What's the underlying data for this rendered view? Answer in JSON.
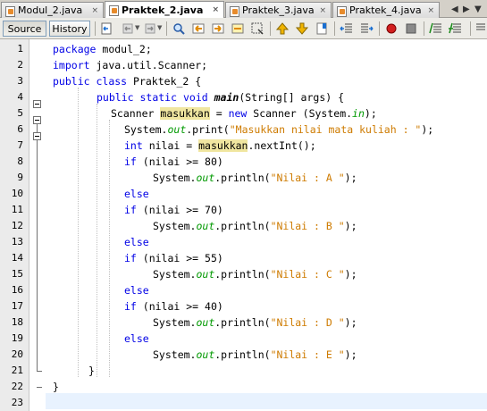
{
  "tabs": [
    {
      "label": "Modul_2.java",
      "active": false
    },
    {
      "label": "Praktek_2.java",
      "active": true
    },
    {
      "label": "Praktek_3.java",
      "active": false
    },
    {
      "label": "Praktek_4.java",
      "active": false
    }
  ],
  "tab_close_glyph": "×",
  "toolbar": {
    "source_label": "Source",
    "history_label": "History"
  },
  "code": {
    "line_numbers": [
      "1",
      "2",
      "3",
      "4",
      "5",
      "6",
      "7",
      "8",
      "9",
      "10",
      "11",
      "12",
      "13",
      "14",
      "15",
      "16",
      "17",
      "18",
      "19",
      "20",
      "21",
      "22",
      "23"
    ],
    "lines": {
      "l1": [
        "package",
        " modul_2;"
      ],
      "l2": [
        "import",
        " java.util.Scanner;"
      ],
      "l3": [
        "public",
        " ",
        "class",
        " Praktek_2 {"
      ],
      "l4": [
        "public",
        " ",
        "static",
        " ",
        "void",
        " ",
        "main",
        "(String[] args) {"
      ],
      "l5": [
        "Scanner ",
        "masukkan",
        " = ",
        "new",
        " Scanner (System.",
        "in",
        ");"
      ],
      "l6": [
        "System.",
        "out",
        ".print(",
        "\"Masukkan nilai mata kuliah : \"",
        ");"
      ],
      "l7": [
        "int",
        " nilai = ",
        "masukkan",
        ".nextInt();"
      ],
      "l8": [
        "if",
        " (nilai >= 80)"
      ],
      "l9": [
        "System.",
        "out",
        ".println(",
        "\"Nilai : A \"",
        ");"
      ],
      "l10": [
        "else"
      ],
      "l11": [
        "if",
        " (nilai >= 70)"
      ],
      "l12": [
        "System.",
        "out",
        ".println(",
        "\"Nilai : B \"",
        ");"
      ],
      "l13": [
        "else"
      ],
      "l14": [
        "if",
        " (nilai >= 55)"
      ],
      "l15": [
        "System.",
        "out",
        ".println(",
        "\"Nilai : C \"",
        ");"
      ],
      "l16": [
        "else"
      ],
      "l17": [
        "if",
        " (nilai >= 40)"
      ],
      "l18": [
        "System.",
        "out",
        ".println(",
        "\"Nilai : D \"",
        ");"
      ],
      "l19": [
        "else"
      ],
      "l20": [
        "System.",
        "out",
        ".println(",
        "\"Nilai : E \"",
        ");"
      ],
      "l21": [
        "}"
      ],
      "l22": [
        "}"
      ]
    }
  },
  "colors": {
    "keyword": "#0000e6",
    "string": "#ce7b00",
    "static_field": "#009900",
    "occurrence_highlight": "#f0e6a0",
    "current_line": "#e8f2fe"
  },
  "icons": [
    "back-icon",
    "forward-icon",
    "last-edit-icon",
    "find-icon",
    "find-previous-icon",
    "find-next-icon",
    "toggle-highlight-icon",
    "find-selection-icon",
    "previous-bookmark-icon",
    "next-bookmark-icon",
    "toggle-bookmark-icon",
    "shift-left-icon",
    "shift-right-icon",
    "start-macro-icon",
    "stop-macro-icon",
    "comment-icon",
    "uncomment-icon"
  ]
}
